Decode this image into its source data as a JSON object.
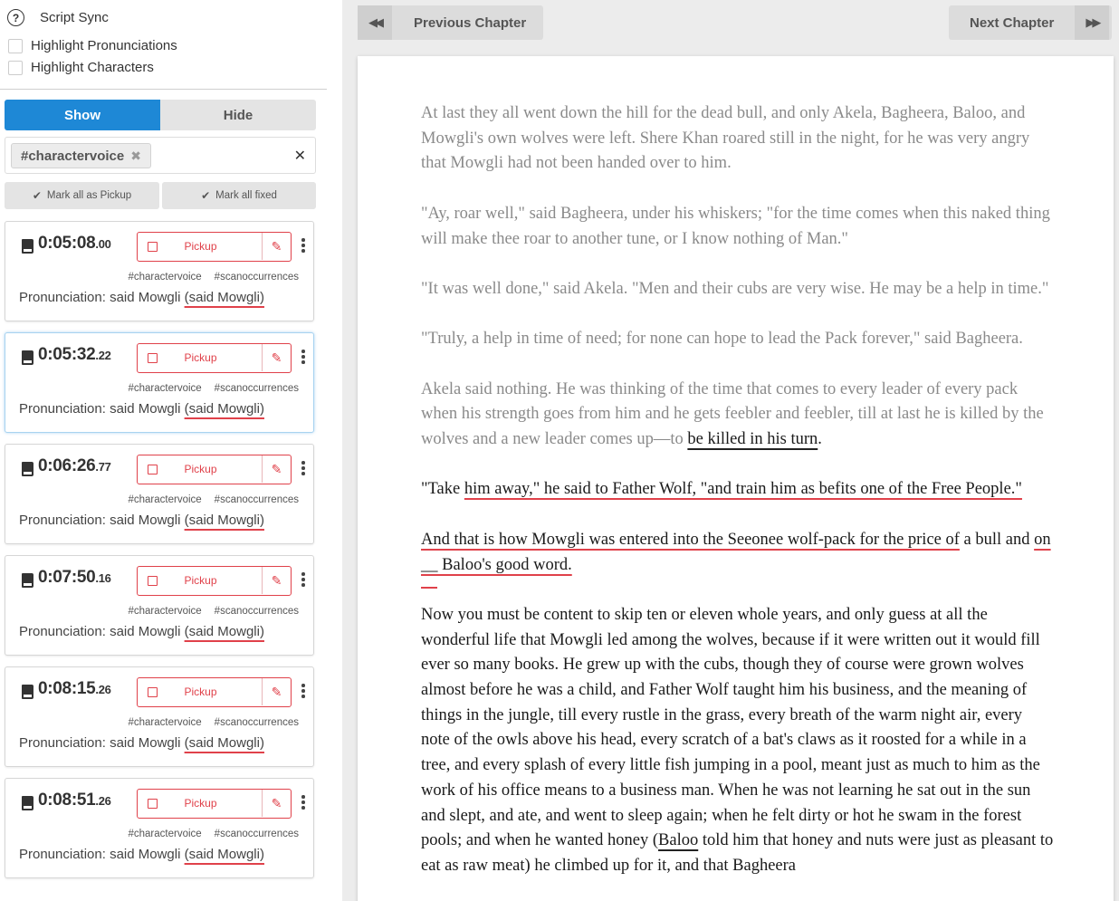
{
  "sidebar": {
    "title": "Script Sync",
    "options": [
      "Highlight Pronunciations",
      "Highlight Characters"
    ],
    "toggle": {
      "show": "Show",
      "hide": "Hide"
    },
    "filter_tag": "#charactervoice",
    "mark_pickup": "Mark all as Pickup",
    "mark_fixed": "Mark all fixed",
    "pickup_label": "Pickup",
    "card_tags": [
      "#charactervoice",
      "#scanoccurrences"
    ],
    "cards": [
      {
        "time_main": "0:05:08",
        "time_frac": ".00",
        "pron_text": "Pronunciation: said Mowgli",
        "pron_paren": "(said Mowgli)"
      },
      {
        "time_main": "0:05:32",
        "time_frac": ".22",
        "pron_text": "Pronunciation: said Mowgli",
        "pron_paren": "(said Mowgli)"
      },
      {
        "time_main": "0:06:26",
        "time_frac": ".77",
        "pron_text": "Pronunciation: said Mowgli",
        "pron_paren": "(said Mowgli)"
      },
      {
        "time_main": "0:07:50",
        "time_frac": ".16",
        "pron_text": "Pronunciation: said Mowgli",
        "pron_paren": "(said Mowgli)"
      },
      {
        "time_main": "0:08:15",
        "time_frac": ".26",
        "pron_text": "Pronunciation: said Mowgli",
        "pron_paren": "(said Mowgli)"
      },
      {
        "time_main": "0:08:51",
        "time_frac": ".26",
        "pron_text": "Pronunciation: said Mowgli",
        "pron_paren": "(said Mowgli)"
      }
    ]
  },
  "nav": {
    "previous": "Previous Chapter",
    "next": "Next Chapter"
  },
  "book": {
    "p1": "At last they all went down the hill for the dead bull, and only Akela, Bagheera, Baloo, and Mowgli's own wolves were left. Shere Khan roared still in the night, for he was very angry that Mowgli had not been handed over to him.",
    "p2": "\"Ay, roar well,\" said Bagheera, under his whiskers; \"for the time comes when this naked thing will make thee roar to another tune, or I know nothing of Man.\"",
    "p3": "\"It was well done,\" said Akela. \"Men and their cubs are very wise. He may be a help in time.\"",
    "p4": "\"Truly, a help in time of need; for none can hope to lead the Pack forever,\" said Bagheera.",
    "p5_a": "Akela said nothing. He was thinking of the time that comes to every leader of every pack when his strength goes from him and he gets feebler and feebler, till at last he is killed by the wolves and a new leader comes up—to ",
    "p5_u": "be killed in his turn",
    "p5_b": ".",
    "p6_a": "\"Take ",
    "p6_u": "him away,\" he said to Father Wolf, \"and train him as befits one of the Free People.\"",
    "p7_u1": "And that is how Mowgli was entered into the Seeonee wolf-pack for the price of",
    "p7_a": " a bull and ",
    "p7_u2": "on __ Baloo's good word.",
    "p8_a": "Now you must be content to skip ten or eleven whole years, and only guess at all the wonderful life that Mowgli led among the wolves, because if it were written out it would fill ever so many books. He grew up with the cubs, though they of course were grown wolves almost before he was a child, and Father Wolf taught him his business, and the meaning of things in the jungle, till every rustle in the grass, every breath of the warm night air, every note of the owls above his head, every scratch of a bat's claws as it roosted for a while in a tree, and every splash of every little fish jumping in a pool, meant just as much to him as the work of his office means to a business man. When he was not learning he sat out in the sun and slept, and ate, and went to sleep again; when he felt dirty or hot he swam in the forest pools; and when he wanted honey (",
    "p8_u": "Baloo",
    "p8_b": " told him that honey and nuts were just as pleasant to eat as raw meat) he climbed up for it, and that Bagheera"
  }
}
